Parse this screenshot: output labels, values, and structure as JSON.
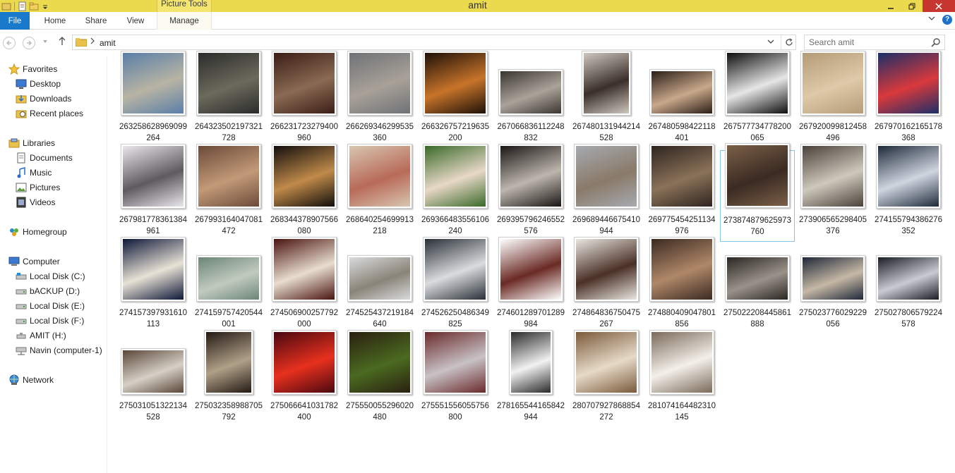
{
  "window": {
    "title": "amit",
    "context_tab_group": "Picture Tools"
  },
  "ribbon": {
    "tabs": {
      "file": "File",
      "home": "Home",
      "share": "Share",
      "view": "View",
      "manage": "Manage"
    },
    "help": "?"
  },
  "address": {
    "path": "amit",
    "search_placeholder": "Search amit"
  },
  "nav": {
    "favorites": "Favorites",
    "desktop": "Desktop",
    "downloads": "Downloads",
    "recent": "Recent places",
    "libraries": "Libraries",
    "documents": "Documents",
    "music": "Music",
    "pictures": "Pictures",
    "videos": "Videos",
    "homegroup": "Homegroup",
    "computer": "Computer",
    "drive_c": "Local Disk (C:)",
    "drive_d": "bACKUP (D:)",
    "drive_e": "Local Disk (E:)",
    "drive_f": "Local Disk (F:)",
    "drive_h": "AMIT (H:)",
    "net_drive": "Navin (computer-1)",
    "network": "Network"
  },
  "files": [
    {
      "l1": "263258628969099",
      "l2": "264",
      "c1": "#5a7ea8",
      "c2": "#b8b4a4"
    },
    {
      "l1": "264323502197321",
      "l2": "728",
      "c1": "#2b2b2b",
      "c2": "#6b6a5c"
    },
    {
      "l1": "266231723279400",
      "l2": "960",
      "c1": "#3a1d17",
      "c2": "#8a6a52"
    },
    {
      "l1": "266269346299535",
      "l2": "360",
      "c1": "#6e7276",
      "c2": "#a8a198"
    },
    {
      "l1": "266326757219635",
      "l2": "200",
      "c1": "#1e1008",
      "c2": "#c8742a"
    },
    {
      "l1": "267066836112248",
      "l2": "832",
      "c1": "#3b3530",
      "c2": "#a9a39a"
    },
    {
      "l1": "267480131944214",
      "l2": "528",
      "c1": "#cfc8bf",
      "c2": "#3a2f2a"
    },
    {
      "l1": "267480598422118",
      "l2": "401",
      "c1": "#2a1e18",
      "c2": "#c9a88a"
    },
    {
      "l1": "267577734778200",
      "l2": "065",
      "c1": "#0e0e0e",
      "c2": "#e6e6e6"
    },
    {
      "l1": "267920099812458",
      "l2": "496",
      "c1": "#b59c78",
      "c2": "#dec9a8"
    },
    {
      "l1": "267970162165178",
      "l2": "368",
      "c1": "#1c2f68",
      "c2": "#d9393c"
    },
    {
      "l1": "267981778361384",
      "l2": "961",
      "c1": "#e9e6ec",
      "c2": "#5e5a60"
    },
    {
      "l1": "267993164047081",
      "l2": "472",
      "c1": "#6a4a38",
      "c2": "#c39a78"
    },
    {
      "l1": "268344378907566",
      "l2": "080",
      "c1": "#120e0c",
      "c2": "#c08a4a"
    },
    {
      "l1": "268640254699913",
      "l2": "218",
      "c1": "#d8c6b0",
      "c2": "#b86a58"
    },
    {
      "l1": "269366483556106",
      "l2": "240",
      "c1": "#3a6a28",
      "c2": "#e8d8c8"
    },
    {
      "l1": "269395796246552",
      "l2": "576",
      "c1": "#1a1614",
      "c2": "#bdb6ae"
    },
    {
      "l1": "269689446675410",
      "l2": "944",
      "c1": "#a6aab0",
      "c2": "#8a7a68"
    },
    {
      "l1": "269775454251134",
      "l2": "976",
      "c1": "#2e2420",
      "c2": "#8a7258"
    },
    {
      "l1": "273874879625973",
      "l2": "760",
      "c1": "#7a6048",
      "c2": "#3a2a22"
    },
    {
      "l1": "273906565298405",
      "l2": "376",
      "c1": "#4a423a",
      "c2": "#cfc8bc"
    },
    {
      "l1": "274155794386276",
      "l2": "352",
      "c1": "#1e2a3a",
      "c2": "#d0d6e0"
    },
    {
      "l1": "274157397931610",
      "l2": "113",
      "c1": "#0e1838",
      "c2": "#e8e2d6"
    },
    {
      "l1": "274159757420544",
      "l2": "001",
      "c1": "#6a8678",
      "c2": "#c2cabf"
    },
    {
      "l1": "274506900257792",
      "l2": "000",
      "c1": "#4a1410",
      "c2": "#e8ddd0"
    },
    {
      "l1": "274525437219184",
      "l2": "640",
      "c1": "#d8dadc",
      "c2": "#8a8478"
    },
    {
      "l1": "274526250486349",
      "l2": "825",
      "c1": "#2a3038",
      "c2": "#dadcde"
    },
    {
      "l1": "274601289701289",
      "l2": "984",
      "c1": "#ffffff",
      "c2": "#6a2a24"
    },
    {
      "l1": "274864836750475",
      "l2": "267",
      "c1": "#e8e6e0",
      "c2": "#4a3026"
    },
    {
      "l1": "274880409047801",
      "l2": "856",
      "c1": "#3a2a22",
      "c2": "#b08868"
    },
    {
      "l1": "275022208445861",
      "l2": "888",
      "c1": "#2a2622",
      "c2": "#9a928a"
    },
    {
      "l1": "275023776029229",
      "l2": "056",
      "c1": "#1e2838",
      "c2": "#c6b8a6"
    },
    {
      "l1": "275027806579224",
      "l2": "578",
      "c1": "#1a1c24",
      "c2": "#c8ccd2"
    },
    {
      "l1": "275031051322134",
      "l2": "528",
      "c1": "#5a4638",
      "c2": "#d6d0c6"
    },
    {
      "l1": "275032358988705",
      "l2": "792",
      "c1": "#241a14",
      "c2": "#b0a088"
    },
    {
      "l1": "275066641031782",
      "l2": "400",
      "c1": "#4a0810",
      "c2": "#e8301e"
    },
    {
      "l1": "275550055296020",
      "l2": "480",
      "c1": "#2a2010",
      "c2": "#4a6a20"
    },
    {
      "l1": "275551556055756",
      "l2": "800",
      "c1": "#6a2a2a",
      "c2": "#c8c2c6"
    },
    {
      "l1": "278165544165842",
      "l2": "944",
      "c1": "#2a2a2a",
      "c2": "#f2f2f2"
    },
    {
      "l1": "280707927868854",
      "l2": "272",
      "c1": "#7a5a3a",
      "c2": "#e6dac8"
    },
    {
      "l1": "281074164482310",
      "l2": "145",
      "c1": "#7a6a5a",
      "c2": "#f4f0ea"
    }
  ]
}
